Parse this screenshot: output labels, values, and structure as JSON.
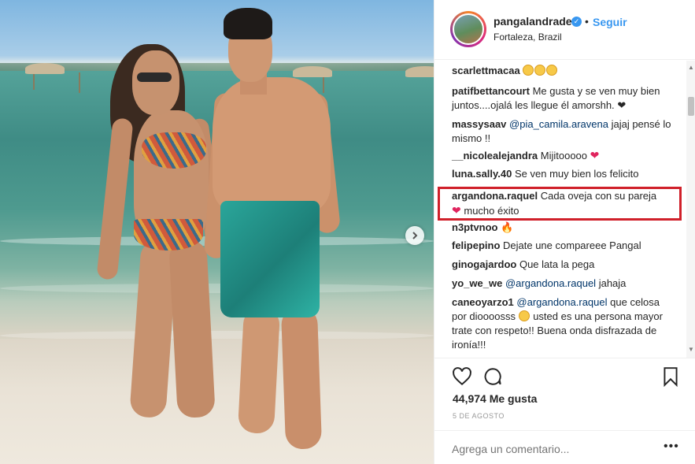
{
  "post": {
    "username": "pangalandrade",
    "verified_icon": "verified-check-icon",
    "separator": "•",
    "follow_label": "Seguir",
    "location": "Fortaleza, Brazil",
    "likes": "44,974 Me gusta",
    "date": "5 DE AGOSTO",
    "add_comment_placeholder": "Agrega un comentario...",
    "more_label": "•••"
  },
  "comments": [
    {
      "user": "scarlettmacaa",
      "text": "",
      "emojis": [
        "face",
        "face",
        "face"
      ]
    },
    {
      "user": "patifbettancourt",
      "text": "Me gusta y se ven muy bien juntos....ojalá les llegue él amorshh.",
      "suffix": "❤"
    },
    {
      "user": "massysaav",
      "mention": "@pia_camila.aravena",
      "text": "jajaj pensé lo mismo !!"
    },
    {
      "user": "__nicolealejandra",
      "text": "Mijitooooo",
      "suffix": "❤"
    },
    {
      "user": "luna.sally.40",
      "text": "Se ven muy bien los felicito"
    },
    {
      "user": "argandona.raquel",
      "text": "Cada oveja con su pareja",
      "suffix": "❤",
      "text2": "mucho éxito"
    },
    {
      "user": "n3ptvnoo",
      "text": "",
      "suffix": "🔥"
    },
    {
      "user": "felipepino",
      "text": "Dejate une compareee Pangal"
    },
    {
      "user": "ginogajardoo",
      "text": "Que lata la pega"
    },
    {
      "user": "yo_we_we",
      "mention": "@argandona.raquel",
      "text": "jahaja"
    },
    {
      "user": "caneoyarzo1",
      "mention": "@argandona.raquel",
      "text": "que celosa por dioooosss",
      "text2": "usted es una persona mayor trate con respeto!! Buena onda disfrazada de ironía!!!"
    }
  ],
  "icons": {
    "like": "heart-outline-icon",
    "comment": "comment-bubble-icon",
    "save": "bookmark-icon",
    "next": "chevron-right-icon"
  },
  "colors": {
    "link_blue": "#3897f0",
    "mention_blue": "#003569",
    "highlight_red": "#d0202a",
    "heart_red": "#e0245e"
  }
}
